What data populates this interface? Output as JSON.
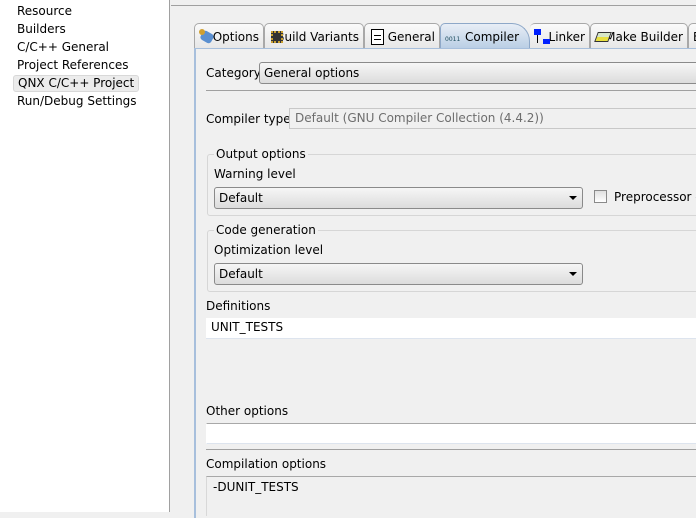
{
  "sidebar": {
    "items": [
      {
        "label": "Resource"
      },
      {
        "label": "Builders"
      },
      {
        "label": "C/C++ General"
      },
      {
        "label": "Project References"
      },
      {
        "label": "QNX C/C++ Project",
        "selected": true
      },
      {
        "label": "Run/Debug Settings"
      }
    ]
  },
  "tabs": [
    {
      "label": "Options",
      "icon": "options-icon"
    },
    {
      "label": "Build Variants",
      "icon": "chip-icon"
    },
    {
      "label": "General",
      "icon": "document-icon"
    },
    {
      "label": "Compiler",
      "icon": "binary-icon",
      "selected": true
    },
    {
      "label": "Linker",
      "icon": "linker-icon"
    },
    {
      "label": "Make Builder",
      "icon": "make-builder-icon"
    },
    {
      "label": "B"
    }
  ],
  "category": {
    "label": "Category",
    "value": "General options"
  },
  "compiler_type": {
    "label": "Compiler type:",
    "value": "Default (GNU Compiler Collection (4.4.2))"
  },
  "output_options": {
    "title": "Output options",
    "warning_label": "Warning level",
    "warning_value": "Default",
    "preprocessor_label": "Preprocessor ou",
    "preprocessor_checked": false
  },
  "code_generation": {
    "title": "Code generation",
    "optimization_label": "Optimization level",
    "optimization_value": "Default"
  },
  "definitions": {
    "label": "Definitions",
    "value": "UNIT_TESTS"
  },
  "other_options": {
    "label": "Other options",
    "value": ""
  },
  "compilation_options": {
    "label": "Compilation options",
    "value": "-DUNIT_TESTS"
  },
  "colors": {
    "selected_tab": "#b8cde4",
    "panel_border": "#a7bfdc"
  }
}
